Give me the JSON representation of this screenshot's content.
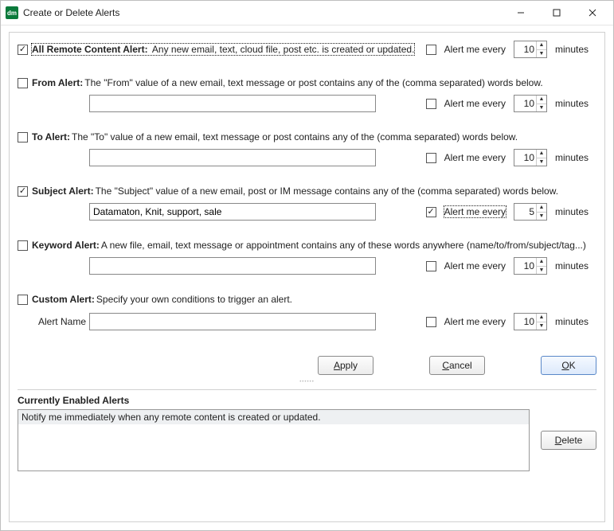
{
  "window": {
    "title": "Create or Delete Alerts",
    "icon_text": "dm"
  },
  "alerts": {
    "remote": {
      "checked": true,
      "label": "All Remote Content Alert:",
      "desc": "Any new email, text, cloud file, post etc. is created or updated.",
      "every_checked": false,
      "every_label": "Alert me every",
      "value": "10",
      "unit": "minutes"
    },
    "from": {
      "checked": false,
      "label": "From Alert:",
      "desc": "The \"From\" value of a new email, text message or post contains any of the (comma separated) words below.",
      "text": "",
      "every_checked": false,
      "every_label": "Alert me every",
      "value": "10",
      "unit": "minutes"
    },
    "to": {
      "checked": false,
      "label": "To Alert:",
      "desc": "The \"To\" value of a new email, text message or post contains any of the (comma separated) words below.",
      "text": "",
      "every_checked": false,
      "every_label": "Alert me every",
      "value": "10",
      "unit": "minutes"
    },
    "subject": {
      "checked": true,
      "label": "Subject Alert:",
      "desc": "The \"Subject\" value of a new email, post or IM message contains any of the (comma separated) words below.",
      "text": "Datamaton, Knit, support, sale",
      "every_checked": true,
      "every_label": "Alert me every",
      "value": "5",
      "unit": "minutes"
    },
    "keyword": {
      "checked": false,
      "label": "Keyword Alert:",
      "desc": "A new file, email, text message or appointment contains any of these words anywhere (name/to/from/subject/tag...)",
      "text": "",
      "every_checked": false,
      "every_label": "Alert me every",
      "value": "10",
      "unit": "minutes"
    },
    "custom": {
      "checked": false,
      "label": "Custom Alert:",
      "desc": "Specify your own conditions to trigger an alert.",
      "name_label": "Alert Name",
      "name_value": "",
      "every_checked": false,
      "every_label": "Alert me every",
      "value": "10",
      "unit": "minutes"
    }
  },
  "buttons": {
    "apply": "Apply",
    "cancel": "Cancel",
    "ok": "OK",
    "delete": "Delete"
  },
  "enabled": {
    "header": "Currently Enabled Alerts",
    "items": [
      "Notify me immediately when any remote content is created or updated."
    ]
  }
}
